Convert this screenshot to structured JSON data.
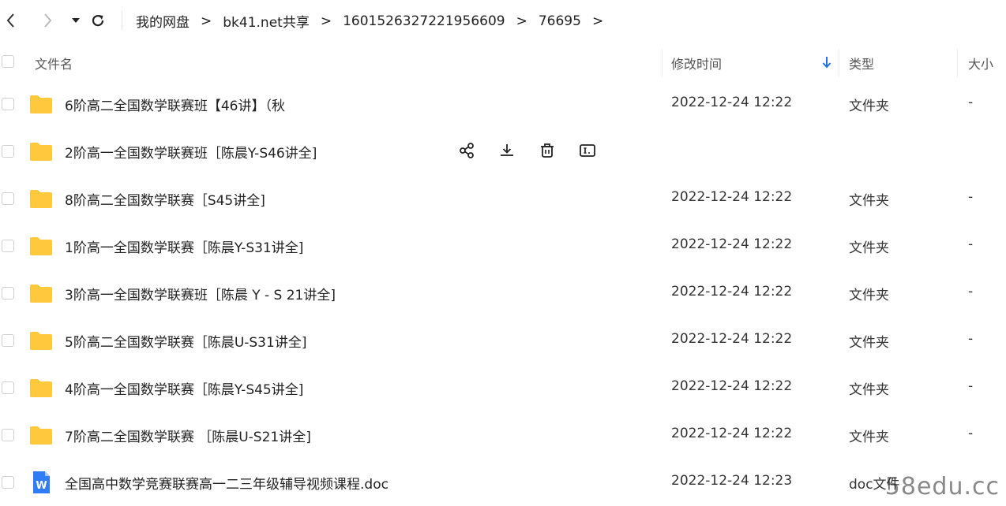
{
  "breadcrumb": {
    "items": [
      "我的网盘",
      "bk41.net共享",
      "1601526327221956609",
      "76695"
    ],
    "separator": ">"
  },
  "columns": {
    "name": "文件名",
    "modified": "修改时间",
    "type": "类型",
    "size": "大小"
  },
  "sort": {
    "column": "modified",
    "direction": "descending",
    "icon": "arrow-down-icon"
  },
  "accent_color": "#1a73e8",
  "folder_color": "#ffc83d",
  "rows": [
    {
      "name": "6阶高二全国数学联赛班【46讲】（秋",
      "date": "2022-12-24 12:22",
      "type": "文件夹",
      "size": "-",
      "icon": "folder-icon"
    },
    {
      "name": "2阶高一全国数学联赛班［陈晨Y-S46讲全]",
      "date": "",
      "type": "",
      "size": "",
      "icon": "folder-icon",
      "hovered": true
    },
    {
      "name": "8阶高二全国数学联赛［S45讲全]",
      "date": "2022-12-24 12:22",
      "type": "文件夹",
      "size": "-",
      "icon": "folder-icon"
    },
    {
      "name": "1阶高一全国数学联赛［陈晨Y-S31讲全]",
      "date": "2022-12-24 12:22",
      "type": "文件夹",
      "size": "-",
      "icon": "folder-icon"
    },
    {
      "name": "3阶高一全国数学联赛班［陈晨 Y - S 21讲全]",
      "date": "2022-12-24 12:22",
      "type": "文件夹",
      "size": "-",
      "icon": "folder-icon"
    },
    {
      "name": "5阶高二全国数学联赛［陈晨U-S31讲全]",
      "date": "2022-12-24 12:22",
      "type": "文件夹",
      "size": "-",
      "icon": "folder-icon"
    },
    {
      "name": "4阶高一全国数学联赛［陈晨Y-S45讲全]",
      "date": "2022-12-24 12:22",
      "type": "文件夹",
      "size": "-",
      "icon": "folder-icon"
    },
    {
      "name": "7阶高二全国数学联赛 ［陈晨U-S21讲全]",
      "date": "2022-12-24 12:22",
      "type": "文件夹",
      "size": "-",
      "icon": "folder-icon"
    },
    {
      "name": "全国高中数学竞赛联赛高一二三年级辅导视频课程.doc",
      "date": "2022-12-24 12:23",
      "type": "doc文件",
      "size": "",
      "icon": "word-doc-icon"
    }
  ],
  "hover_actions": [
    "share-icon",
    "download-icon",
    "delete-icon",
    "rename-icon"
  ],
  "watermark": "58edu.cc"
}
